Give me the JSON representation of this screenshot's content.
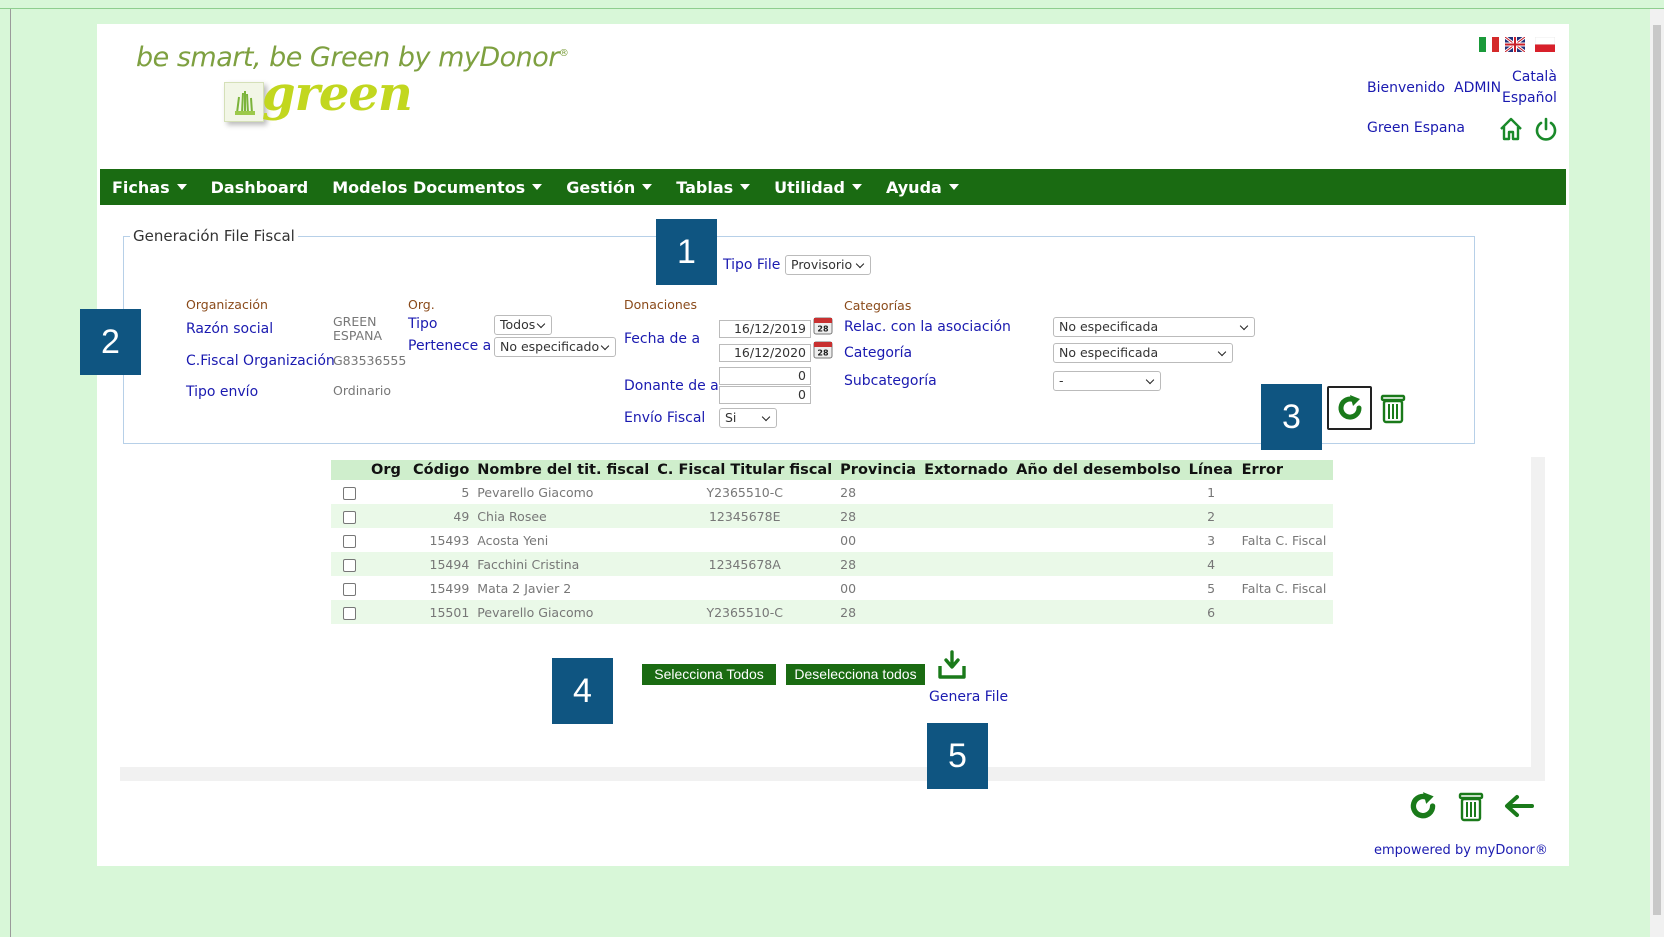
{
  "header": {
    "logo_tagline": "be smart, be Green by myDonor",
    "logo_reg": "®",
    "logo_word": "green",
    "languages": [
      "Català",
      "Español"
    ],
    "welcome_label": "Bienvenido",
    "user": "ADMIN",
    "org_name": "Green Espana"
  },
  "nav": [
    {
      "label": "Fichas",
      "dropdown": true
    },
    {
      "label": "Dashboard",
      "dropdown": false
    },
    {
      "label": "Modelos Documentos",
      "dropdown": true
    },
    {
      "label": "Gestión",
      "dropdown": true
    },
    {
      "label": "Tablas",
      "dropdown": true
    },
    {
      "label": "Utilidad",
      "dropdown": true
    },
    {
      "label": "Ayuda",
      "dropdown": true
    }
  ],
  "form": {
    "legend": "Generación File Fiscal",
    "tipo_file_label": "Tipo File",
    "tipo_file_value": "Provisorio",
    "organizacion_header": "Organización",
    "razon_social_label": "Razón social",
    "razon_social_value_1": "GREEN",
    "razon_social_value_2": "ESPANA",
    "cfiscal_label": "C.Fiscal Organización",
    "cfiscal_value": "G83536555",
    "tipo_envio_label": "Tipo envío",
    "tipo_envio_value": "Ordinario",
    "org_header": "Org.",
    "tipo_label": "Tipo",
    "tipo_value": "Todos",
    "pertenece_label": "Pertenece a",
    "pertenece_value": "No especificado",
    "donaciones_header": "Donaciones",
    "fecha_label": "Fecha de a",
    "fecha_from": "16/12/2019",
    "fecha_to": "16/12/2020",
    "donante_label": "Donante de a",
    "donante_from": "0",
    "donante_to": "0",
    "envio_fiscal_label": "Envío Fiscal",
    "envio_fiscal_value": "Si",
    "categorias_header": "Categorías",
    "relac_label": "Relac. con la asociación",
    "relac_value": "No especificada",
    "categoria_label": "Categoría",
    "categoria_value": "No especificada",
    "subcategoria_label": "Subcategoría",
    "subcategoria_value": "-"
  },
  "markers": [
    "1",
    "2",
    "3",
    "4",
    "5"
  ],
  "table": {
    "columns": [
      "",
      "Org",
      "Código",
      "Nombre del tit. fiscal",
      "C. Fiscal Titular fiscal",
      "Provincia",
      "Extornado",
      "Año del desembolso",
      "Línea",
      "Error"
    ],
    "rows": [
      {
        "codigo": "5",
        "nombre": "Pevarello Giacomo",
        "cfiscal": "Y2365510-C",
        "provincia": "28",
        "extornado": "",
        "anio": "",
        "linea": "1",
        "error": ""
      },
      {
        "codigo": "49",
        "nombre": "Chia Rosee",
        "cfiscal": "12345678E",
        "provincia": "28",
        "extornado": "",
        "anio": "",
        "linea": "2",
        "error": ""
      },
      {
        "codigo": "15493",
        "nombre": "Acosta Yeni",
        "cfiscal": "",
        "provincia": "00",
        "extornado": "",
        "anio": "",
        "linea": "3",
        "error": "Falta C. Fiscal"
      },
      {
        "codigo": "15494",
        "nombre": "Facchini Cristina",
        "cfiscal": "12345678A",
        "provincia": "28",
        "extornado": "",
        "anio": "",
        "linea": "4",
        "error": ""
      },
      {
        "codigo": "15499",
        "nombre": "Mata 2 Javier 2",
        "cfiscal": "",
        "provincia": "00",
        "extornado": "",
        "anio": "",
        "linea": "5",
        "error": "Falta C. Fiscal"
      },
      {
        "codigo": "15501",
        "nombre": "Pevarello Giacomo",
        "cfiscal": "Y2365510-C",
        "provincia": "28",
        "extornado": "",
        "anio": "",
        "linea": "6",
        "error": ""
      }
    ]
  },
  "actions": {
    "select_all": "Selecciona Todos",
    "deselect_all": "Deselecciona todos",
    "genera_file": "Genera File"
  },
  "footer": "empowered by myDonor®",
  "colors": {
    "page_bg": "#d8f7d8",
    "nav_bg": "#1a6b12",
    "link": "#1a1ab0",
    "header_label": "#8a4a1a",
    "table_head": "#cfeecc",
    "marker_bg": "#0f5581",
    "icon_green": "#1a7a1a"
  }
}
